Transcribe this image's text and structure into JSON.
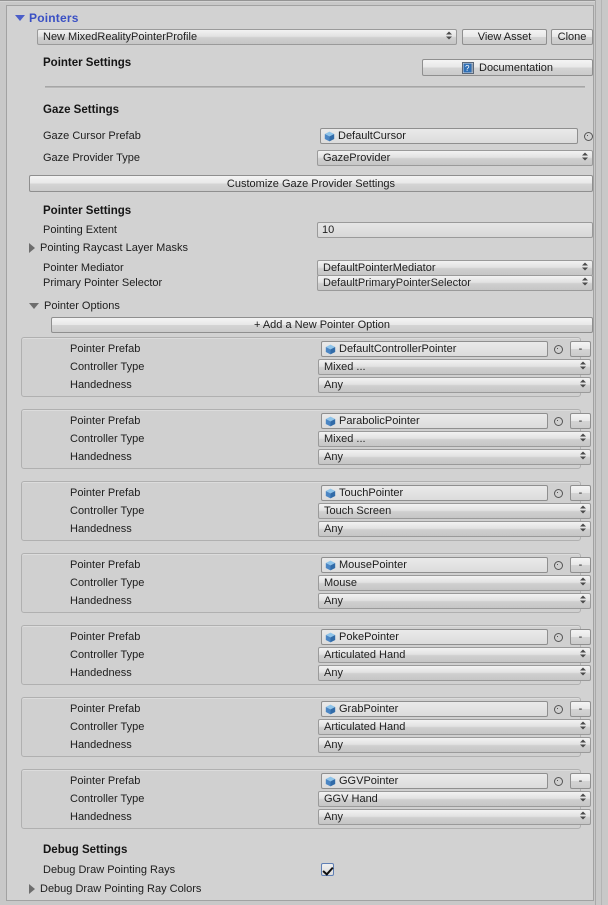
{
  "window": {
    "header_title": "Pointers",
    "accent_color": "#3a50c4",
    "background_color": "#d2d2d2"
  },
  "profile_bar": {
    "profile_name": "New MixedRealityPointerProfile",
    "view_asset_label": "View Asset",
    "clone_label": "Clone"
  },
  "pointer_settings_header": {
    "title": "Pointer Settings",
    "documentation_label": "Documentation"
  },
  "gaze_settings": {
    "title": "Gaze Settings",
    "cursor_prefab_label": "Gaze Cursor Prefab",
    "cursor_prefab_value": "DefaultCursor",
    "provider_type_label": "Gaze Provider Type",
    "provider_type_value": "GazeProvider",
    "customize_button_label": "Customize Gaze Provider Settings"
  },
  "pointer_settings": {
    "title": "Pointer Settings",
    "pointing_extent_label": "Pointing Extent",
    "pointing_extent_value": "10",
    "raycast_layer_masks_label": "Pointing Raycast Layer Masks",
    "pointer_mediator_label": "Pointer Mediator",
    "pointer_mediator_value": "DefaultPointerMediator",
    "primary_pointer_selector_label": "Primary Pointer Selector",
    "primary_pointer_selector_value": "DefaultPrimaryPointerSelector"
  },
  "pointer_options": {
    "title": "Pointer Options",
    "add_button_label": "+ Add a New Pointer Option",
    "field_labels": {
      "prefab": "Pointer Prefab",
      "controller_type": "Controller Type",
      "handedness": "Handedness"
    },
    "remove_label": "-",
    "items": [
      {
        "prefab": "DefaultControllerPointer",
        "controller_type": "Mixed ...",
        "handedness": "Any"
      },
      {
        "prefab": "ParabolicPointer",
        "controller_type": "Mixed ...",
        "handedness": "Any"
      },
      {
        "prefab": "TouchPointer",
        "controller_type": "Touch Screen",
        "handedness": "Any"
      },
      {
        "prefab": "MousePointer",
        "controller_type": "Mouse",
        "handedness": "Any"
      },
      {
        "prefab": "PokePointer",
        "controller_type": "Articulated Hand",
        "handedness": "Any"
      },
      {
        "prefab": "GrabPointer",
        "controller_type": "Articulated Hand",
        "handedness": "Any"
      },
      {
        "prefab": "GGVPointer",
        "controller_type": "GGV Hand",
        "handedness": "Any"
      }
    ]
  },
  "debug_settings": {
    "title": "Debug Settings",
    "draw_pointing_rays_label": "Debug Draw Pointing Rays",
    "draw_pointing_rays_checked": true,
    "ray_colors_label": "Debug Draw Pointing Ray Colors"
  }
}
